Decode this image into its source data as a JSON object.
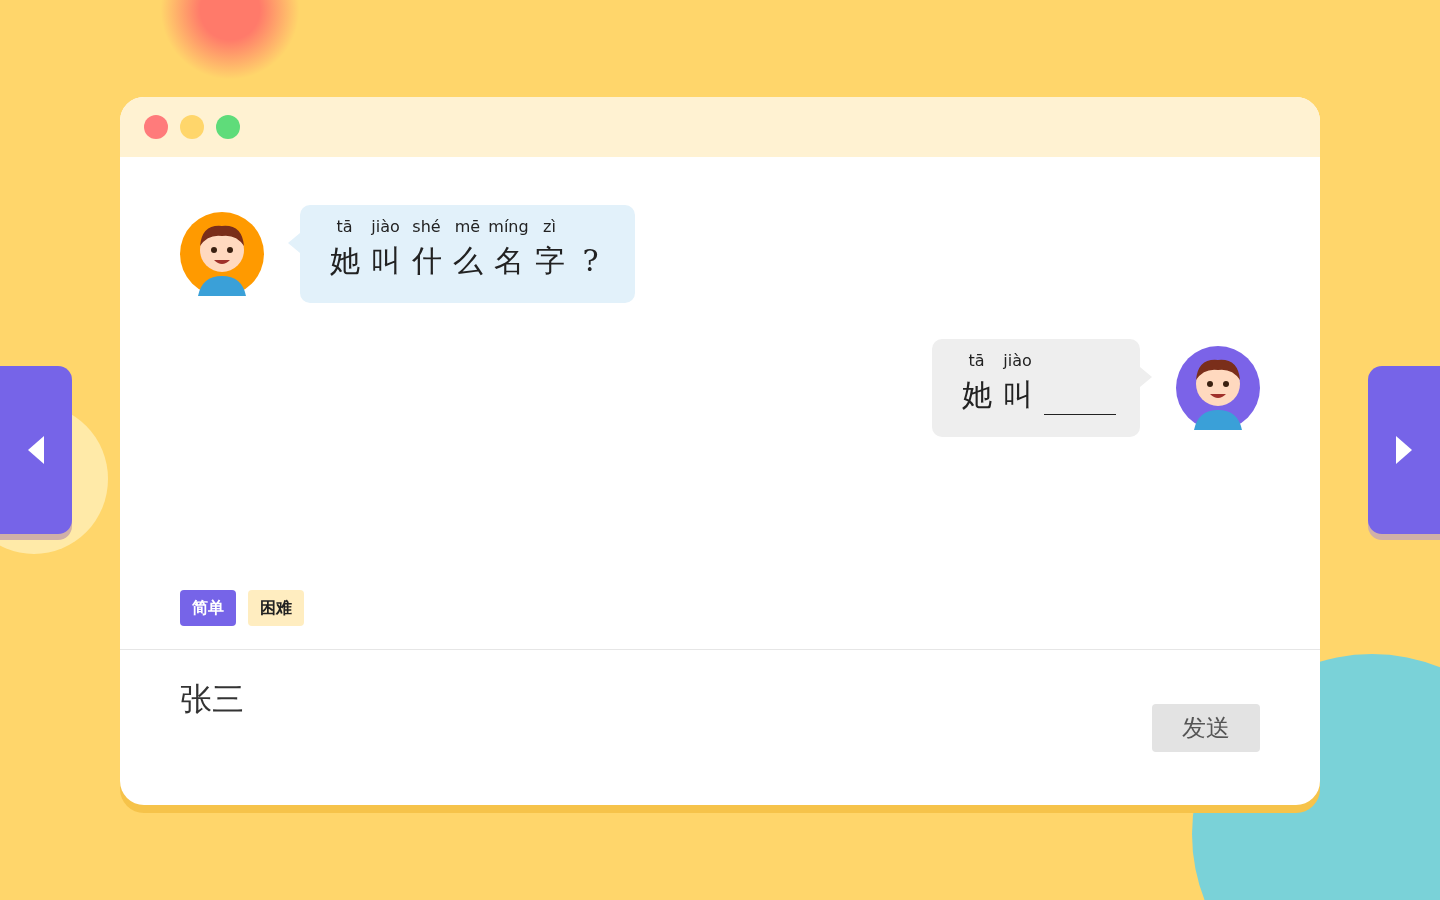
{
  "messages": [
    {
      "kind": "question",
      "units": [
        {
          "pinyin": "tā",
          "hanzi": "她"
        },
        {
          "pinyin": "jiào",
          "hanzi": "叫"
        },
        {
          "pinyin": "shé",
          "hanzi": "什"
        },
        {
          "pinyin": "mē",
          "hanzi": "么"
        },
        {
          "pinyin": "míng",
          "hanzi": "名"
        },
        {
          "pinyin": "zì",
          "hanzi": "字"
        },
        {
          "hanzi": "?"
        }
      ]
    },
    {
      "kind": "answer",
      "units": [
        {
          "pinyin": "tā",
          "hanzi": "她"
        },
        {
          "pinyin": "jiào",
          "hanzi": "叫"
        },
        {
          "blank": true
        }
      ]
    }
  ],
  "difficulty": [
    {
      "label": "简单",
      "selected": true
    },
    {
      "label": "困难",
      "selected": false
    }
  ],
  "input": {
    "value": "张三"
  },
  "send_button": "发送"
}
